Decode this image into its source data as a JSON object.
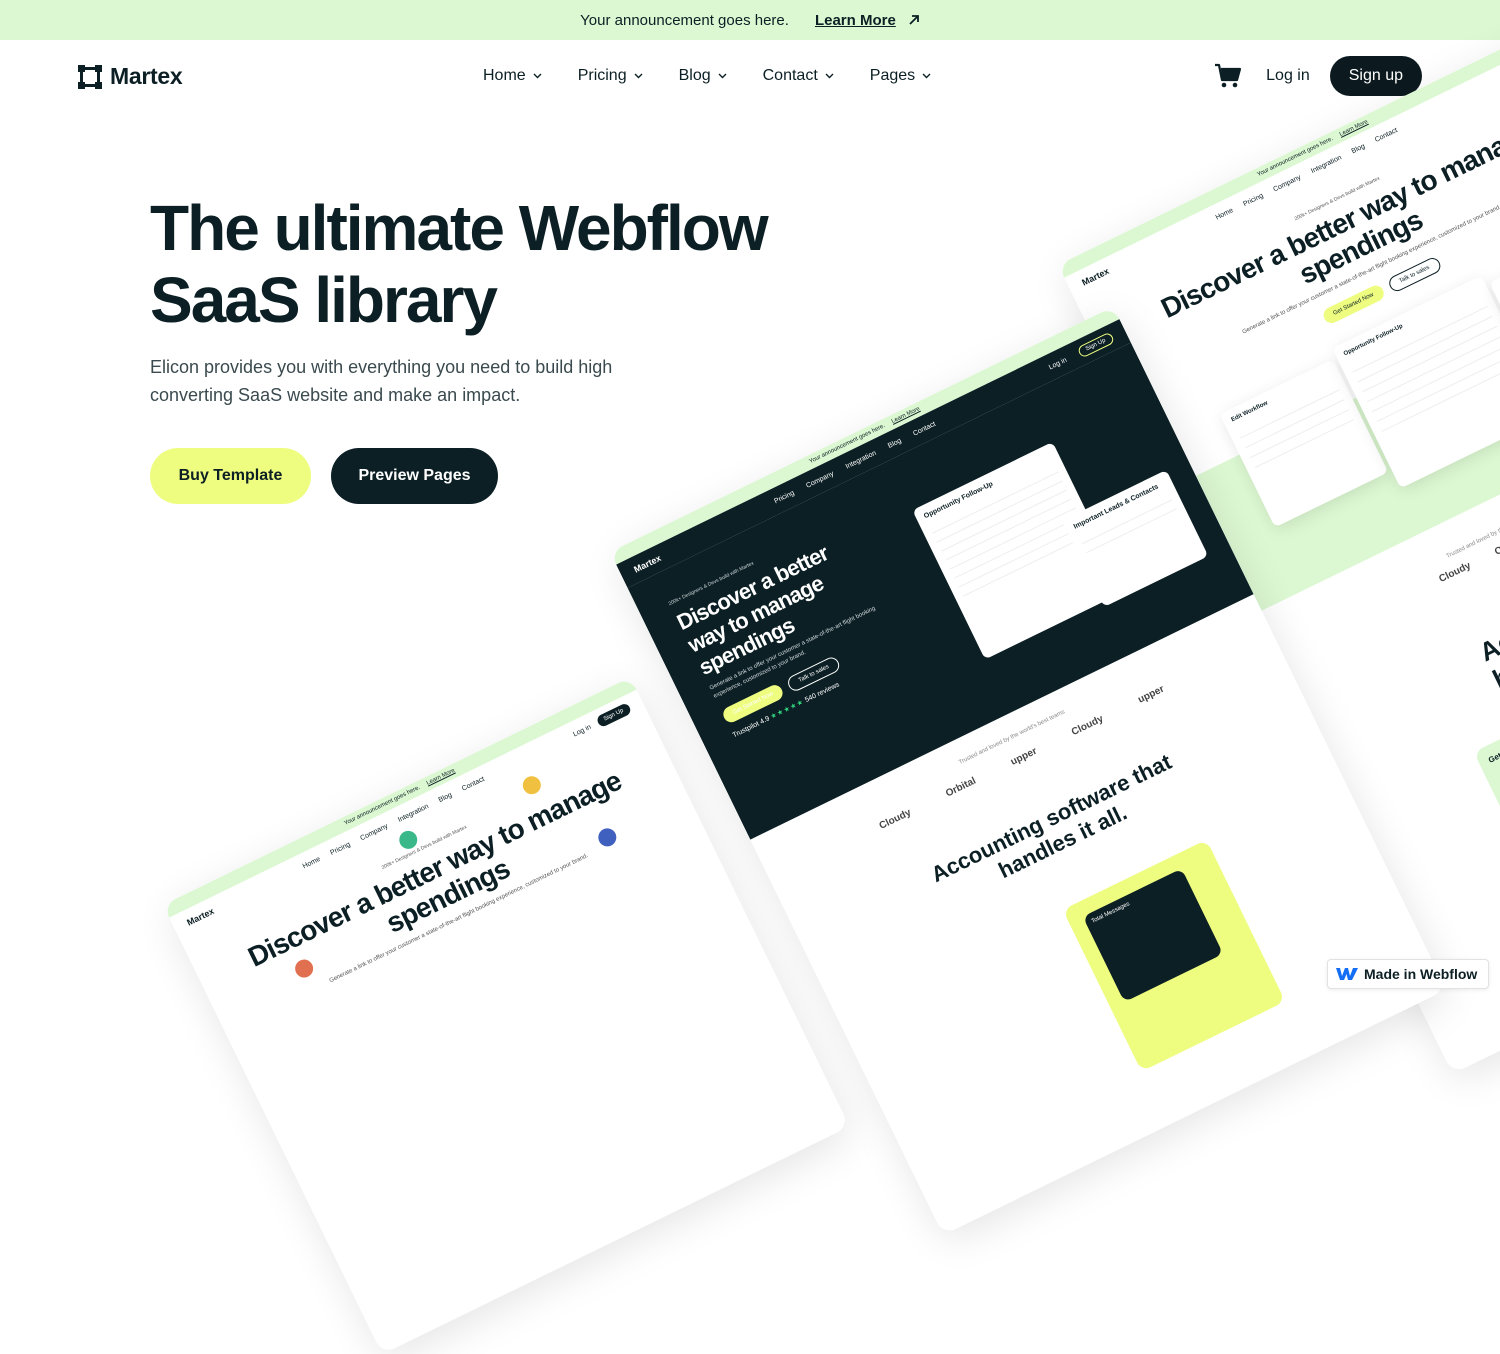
{
  "announcement": {
    "text": "Your announcement goes here.",
    "link_label": "Learn More"
  },
  "nav": {
    "brand": "Martex",
    "menu": [
      {
        "label": "Home"
      },
      {
        "label": "Pricing"
      },
      {
        "label": "Blog"
      },
      {
        "label": "Contact"
      },
      {
        "label": "Pages"
      }
    ],
    "login_label": "Log in",
    "signup_label": "Sign up"
  },
  "hero": {
    "title": "The ultimate Webflow SaaS library",
    "subtitle": "Elicon provides you with everything you need to build high converting SaaS website and make an impact.",
    "buy_label": "Buy Template",
    "preview_label": "Preview Pages"
  },
  "mockups": {
    "announcement": "Your announcement goes here.",
    "learn_more": "Learn More",
    "brand": "Martex",
    "links": [
      "Home",
      "Pricing",
      "Company",
      "Integration",
      "Blog",
      "Contact"
    ],
    "login": "Log in",
    "signup": "Sign Up",
    "badge": "200k+ Designers & Devs build with Martex",
    "headline": "Discover a better way to manage spendings",
    "desc": "Generate a link to offer your customer a state-of-the-art flight booking experience, customized to your brand.",
    "get_started": "Get Started Now",
    "talk_sales": "Talk to sales",
    "trustpilot": "Trustpilot",
    "rating": "4.9",
    "reviews": "540 reviews",
    "trusted": "Trusted and loved by the world's best teams",
    "logos": [
      "Cloudy",
      "Orbital",
      "upper",
      "Cloudy",
      "upper"
    ],
    "opportunity": "Opportunity Follow-Up",
    "leads": "Important Leads & Contacts",
    "edit_workflow": "Edit Workflow",
    "accounting": "Accounting software that handles it all.",
    "visibility": "Get complete visibility",
    "total_messages": "Total Messages"
  },
  "badge": {
    "label": "Made in Webflow"
  },
  "colors": {
    "ink": "#0c1f24",
    "announcement_bg": "#dcf8d2",
    "accent_yellow": "#eefd80"
  }
}
